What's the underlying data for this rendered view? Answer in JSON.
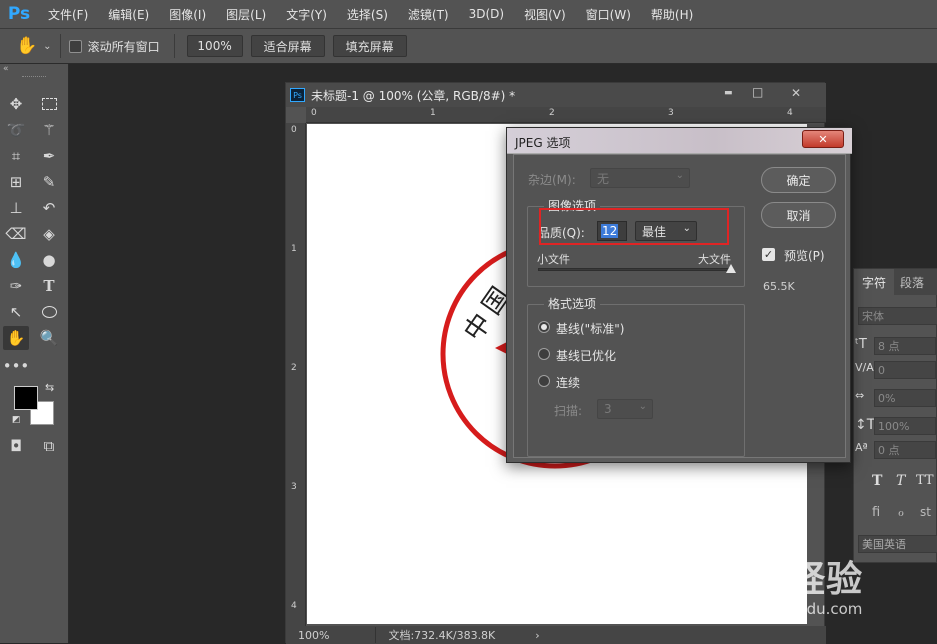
{
  "app": {
    "logo": "Ps"
  },
  "menu": [
    "文件(F)",
    "编辑(E)",
    "图像(I)",
    "图层(L)",
    "文字(Y)",
    "选择(S)",
    "滤镜(T)",
    "3D(D)",
    "视图(V)",
    "窗口(W)",
    "帮助(H)"
  ],
  "options": {
    "scroll_all_label": "滚动所有窗口",
    "zoom_value": "100%",
    "fit_screen": "适合屏幕",
    "fill_screen": "填充屏幕"
  },
  "document": {
    "ps_badge": "Ps",
    "title": "未标题-1 @ 100% (公章, RGB/8#) *",
    "minimize": "▬",
    "maximize": "□",
    "close": "✕",
    "ruler_top": [
      "0",
      "1",
      "2",
      "3",
      "4"
    ],
    "ruler_left": [
      "0",
      "1",
      "2",
      "3",
      "4"
    ],
    "stamp_text": "中国",
    "status_zoom": "100%",
    "status_doc": "文档:732.4K/383.8K"
  },
  "dialog": {
    "title": "JPEG 选项",
    "close": "✕",
    "matte_label": "杂边(M):",
    "matte_value": "无",
    "image_options_legend": "图像选项",
    "quality_label": "品质(Q):",
    "quality_value": "12",
    "quality_preset": "最佳",
    "small_file": "小文件",
    "large_file": "大文件",
    "quality_level": 1.0,
    "format_legend": "格式选项",
    "format_options": [
      "基线(\"标准\")",
      "基线已优化",
      "连续"
    ],
    "format_selected": 0,
    "scans_label": "扫描:",
    "scans_value": "3",
    "ok_button": "确定",
    "cancel_button": "取消",
    "preview_label": "预览(P)",
    "file_size": "65.5K",
    "highlight_color": "#e02424"
  },
  "char_panel": {
    "tabs": [
      "字符",
      "段落"
    ],
    "font_family": "宋体",
    "size": "8 点",
    "kerning": "0",
    "tracking": "0%",
    "vscale": "100%",
    "baseline": "0 点",
    "language": "美国英语"
  },
  "watermark": {
    "brand": "Bai経验",
    "url": "jingyan.baidu.com"
  }
}
